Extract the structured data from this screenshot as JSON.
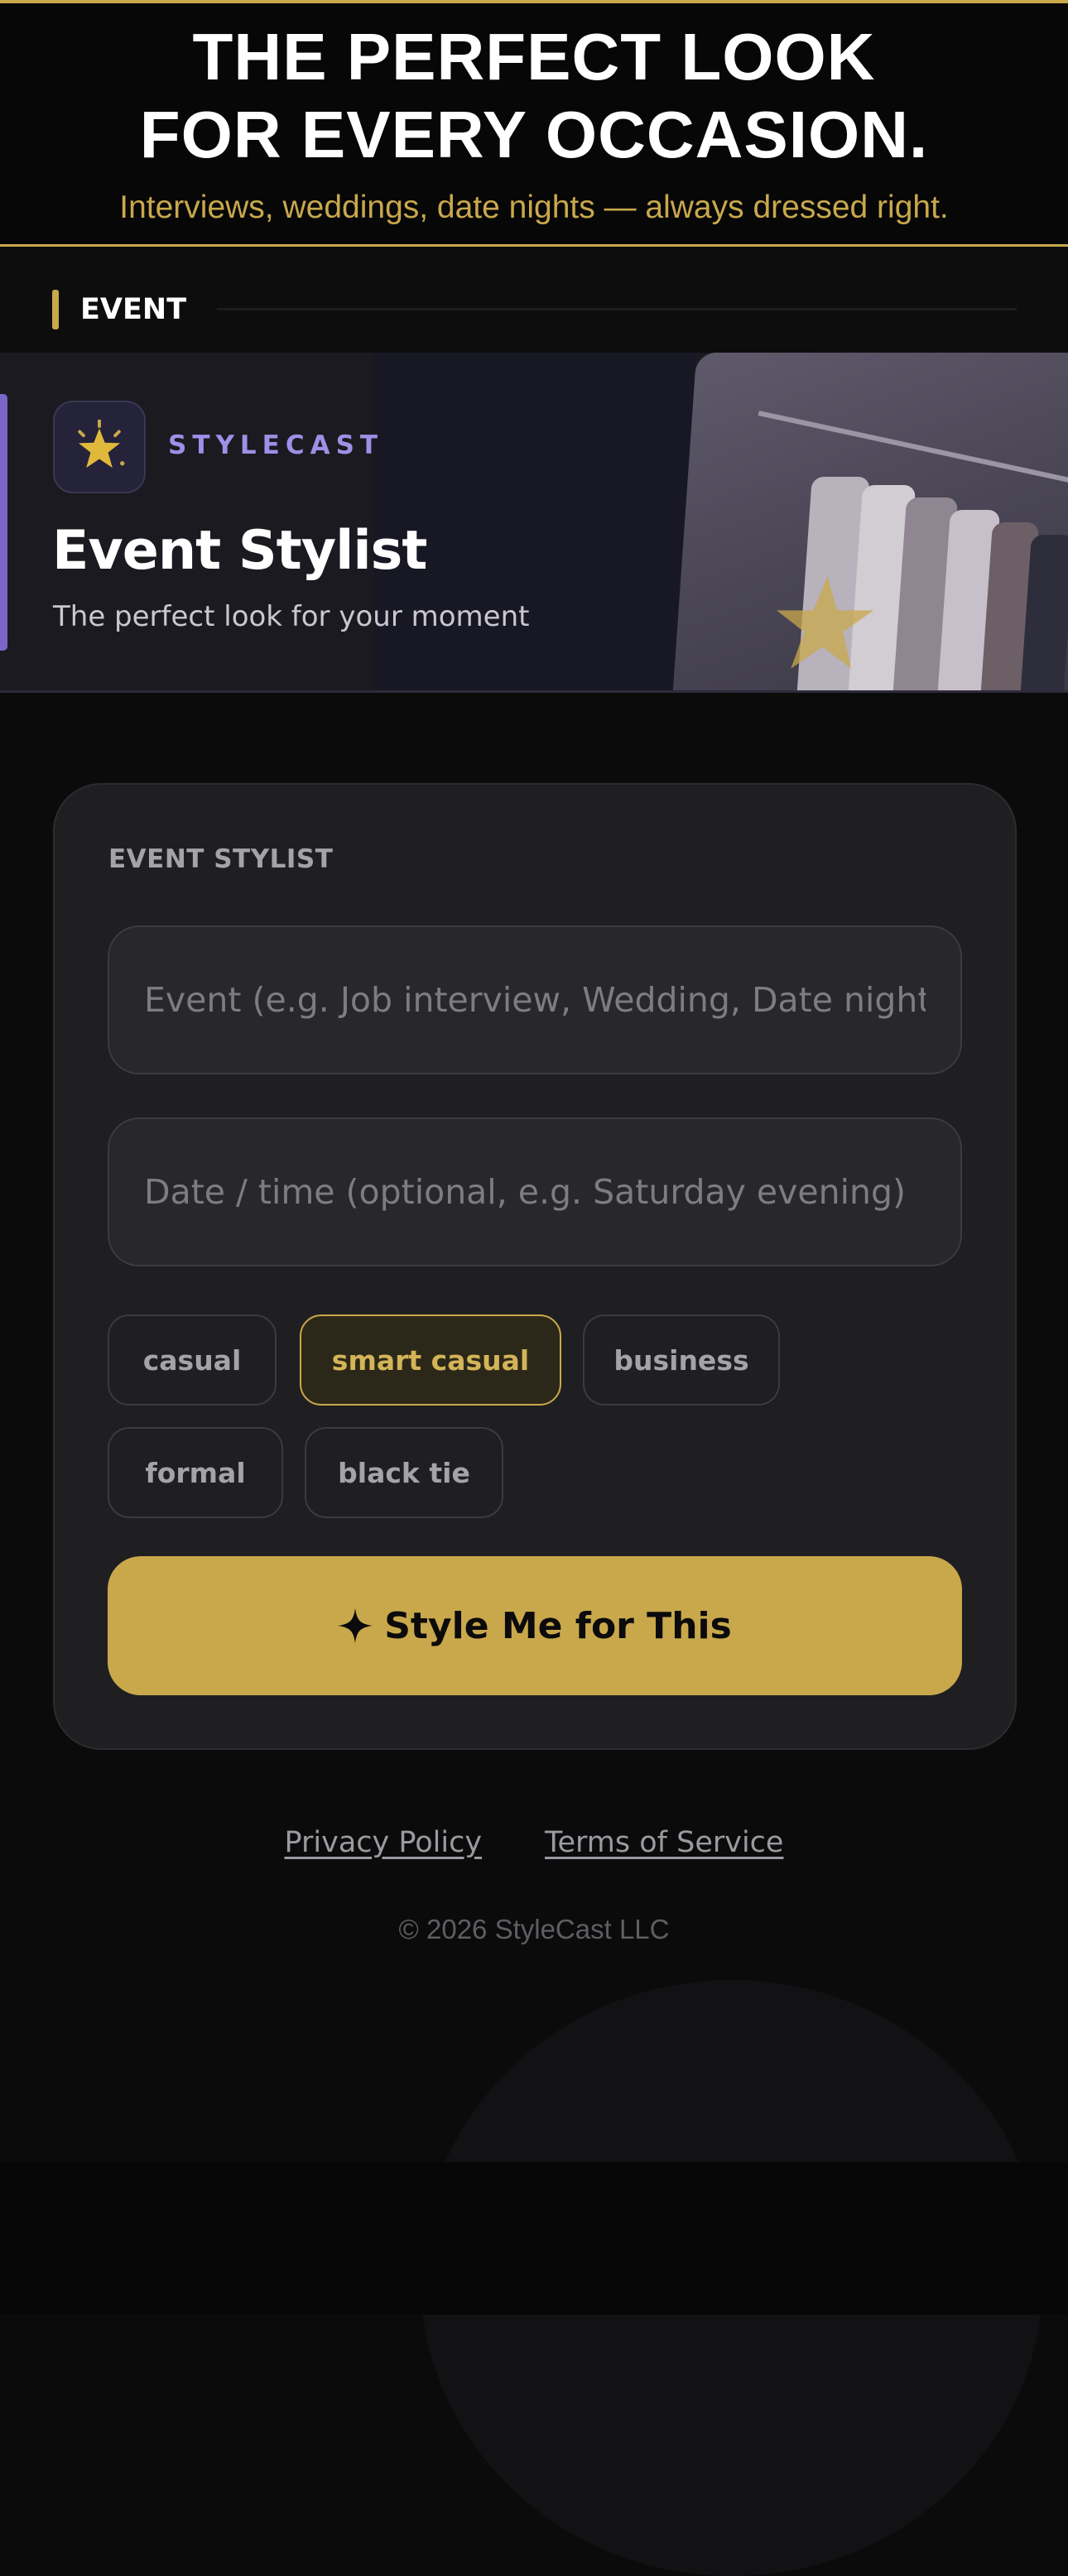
{
  "promo": {
    "title_line1": "THE PERFECT LOOK",
    "title_line2": "FOR EVERY OCCASION.",
    "subtitle": "Interviews, weddings, date nights — always dressed right."
  },
  "section": {
    "label": "EVENT"
  },
  "hero": {
    "brand": "STYLECAST",
    "brand_icon": "star-icon",
    "title": "Event Stylist",
    "subtitle": "The perfect look for your moment"
  },
  "card": {
    "label": "EVENT STYLIST",
    "event_placeholder": "Event (e.g. Job interview, Wedding, Date night)",
    "date_placeholder": "Date / time (optional, e.g. Saturday evening)",
    "chips": [
      {
        "label": "casual",
        "active": false
      },
      {
        "label": "smart casual",
        "active": true
      },
      {
        "label": "business",
        "active": false
      },
      {
        "label": "formal",
        "active": false
      },
      {
        "label": "black tie",
        "active": false
      }
    ],
    "cta_icon": "sparkle-icon",
    "cta_label": "Style Me for This"
  },
  "footer": {
    "privacy": "Privacy Policy",
    "terms": "Terms of Service",
    "copyright": "© 2026 StyleCast LLC"
  },
  "colors": {
    "accent_gold": "#c9a84c",
    "accent_purple": "#9f8fe6",
    "background": "#0b0b0c",
    "card": "#1f1f21"
  }
}
